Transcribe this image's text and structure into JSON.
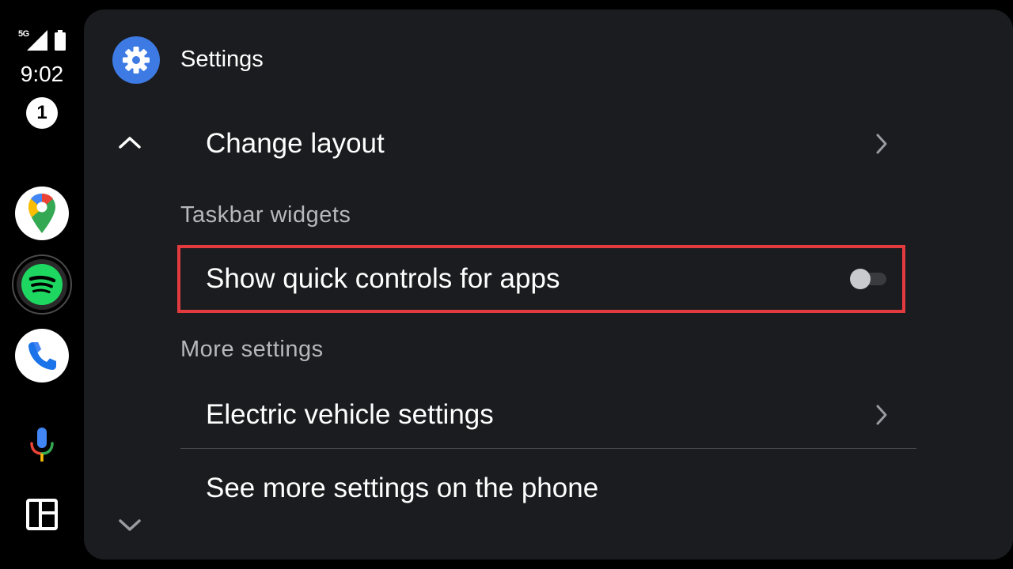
{
  "status": {
    "network": "5G",
    "time": "9:02",
    "notification_count": "1"
  },
  "rail": {
    "apps": [
      {
        "name": "Google Maps",
        "icon": "maps-icon"
      },
      {
        "name": "Spotify",
        "icon": "spotify-icon"
      },
      {
        "name": "Phone",
        "icon": "phone-icon"
      }
    ],
    "mic_icon": "microphone-icon",
    "dashboard_icon": "dashboard-icon"
  },
  "header": {
    "title": "Settings",
    "icon": "gear-icon"
  },
  "settings": {
    "change_layout": "Change layout",
    "taskbar_header": "Taskbar widgets",
    "quick_controls": "Show quick controls for apps",
    "quick_controls_enabled": false,
    "more_header": "More settings",
    "ev_settings": "Electric vehicle settings",
    "see_more": "See more settings on the phone"
  },
  "colors": {
    "panel_bg": "#1b1c1f",
    "accent_blue": "#3d7ae3",
    "highlight_red": "#e23b3f",
    "spotify_green": "#1ed760"
  }
}
